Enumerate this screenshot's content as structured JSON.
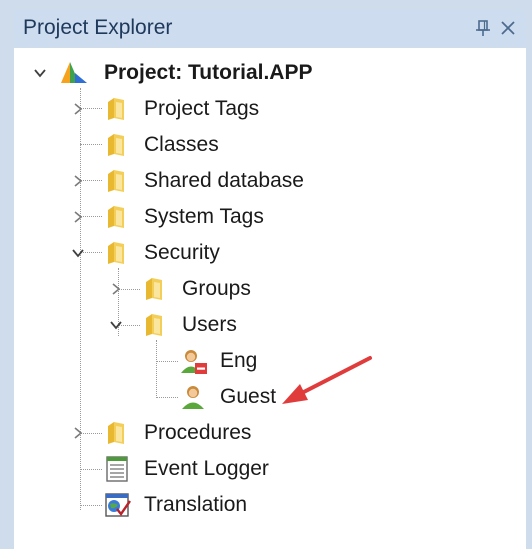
{
  "panel": {
    "title": "Project Explorer",
    "pin_glyph": "ё",
    "close_glyph": "✕"
  },
  "tree": {
    "root": {
      "label": "Project: Tutorial.APP",
      "icon": "project-icon"
    },
    "items": [
      {
        "label": "Project Tags",
        "icon": "folder-icon"
      },
      {
        "label": "Classes",
        "icon": "folder-icon"
      },
      {
        "label": "Shared database",
        "icon": "folder-icon"
      },
      {
        "label": "System Tags",
        "icon": "folder-icon"
      },
      {
        "label": "Security",
        "icon": "folder-icon"
      },
      {
        "label": "Groups",
        "icon": "folder-icon"
      },
      {
        "label": "Users",
        "icon": "folder-icon"
      },
      {
        "label": "Eng",
        "icon": "user-disabled-icon"
      },
      {
        "label": "Guest",
        "icon": "user-icon"
      },
      {
        "label": "Procedures",
        "icon": "folder-icon"
      },
      {
        "label": "Event Logger",
        "icon": "log-icon"
      },
      {
        "label": "Translation",
        "icon": "translation-icon"
      }
    ]
  },
  "colors": {
    "titlebar_bg": "#cddcee",
    "titlebar_text": "#1e395b",
    "folder": "#e8b830",
    "arrow": "#e03c3c"
  }
}
